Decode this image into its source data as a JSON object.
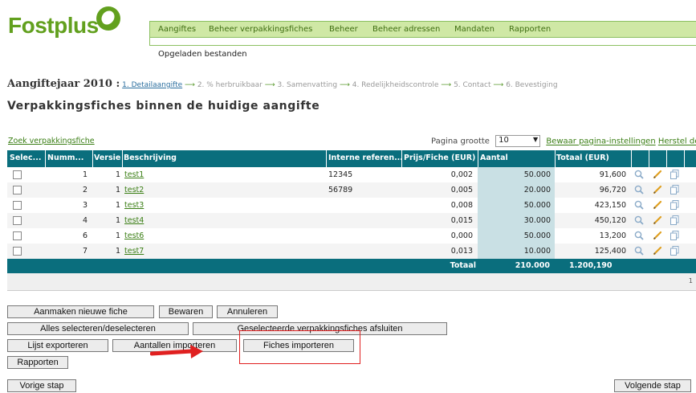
{
  "brand": {
    "name": "Fostplus",
    "color": "#62a01e"
  },
  "top_cut_text": "",
  "nav": {
    "items": [
      "Aangiftes",
      "Beheer verpakkingsfiches",
      "Beheer",
      "Beheer adressen",
      "Mandaten",
      "Rapporten"
    ],
    "sub": "Opgeladen bestanden"
  },
  "steps": {
    "year_label": "Aangiftejaar 2010 :",
    "items": [
      "1. Detailaangifte",
      "2. % herbruikbaar",
      "3. Samenvatting",
      "4. Redelijkheidscontrole",
      "5. Contact",
      "6. Bevestiging"
    ],
    "arrow": "⟶"
  },
  "title": "Verpakkingsfiches binnen de huidige aangifte",
  "search_link": "Zoek verpakkingsfiche",
  "paging": {
    "label": "Pagina grootte",
    "size": "10",
    "save_link": "Bewaar pagina-instellingen",
    "reset_link": "Herstel defau"
  },
  "table": {
    "headers": [
      "Selec...",
      "Numm...",
      "Versie",
      "Beschrijving",
      "Interne referen...",
      "Prijs/Fiche (EUR)",
      "Aantal",
      "Totaal (EUR)"
    ],
    "rows": [
      {
        "num": "1",
        "versie": "1",
        "desc": "test1",
        "ref": "12345",
        "prijs": "0,002",
        "aantal": "50.000",
        "totaal": "91,600"
      },
      {
        "num": "2",
        "versie": "1",
        "desc": "test2",
        "ref": "56789",
        "prijs": "0,005",
        "aantal": "20.000",
        "totaal": "96,720"
      },
      {
        "num": "3",
        "versie": "1",
        "desc": "test3",
        "ref": "",
        "prijs": "0,008",
        "aantal": "50.000",
        "totaal": "423,150"
      },
      {
        "num": "4",
        "versie": "1",
        "desc": "test4",
        "ref": "",
        "prijs": "0,015",
        "aantal": "30.000",
        "totaal": "450,120"
      },
      {
        "num": "6",
        "versie": "1",
        "desc": "test6",
        "ref": "",
        "prijs": "0,000",
        "aantal": "50.000",
        "totaal": "13,200"
      },
      {
        "num": "7",
        "versie": "1",
        "desc": "test7",
        "ref": "",
        "prijs": "0,013",
        "aantal": "10.000",
        "totaal": "125,400"
      }
    ],
    "totals": {
      "label": "Totaal",
      "aantal": "210.000",
      "totaal": "1.200,190"
    },
    "page_number": "1",
    "header_color": "#0a6e7d"
  },
  "buttons": {
    "new_fiche": "Aanmaken nieuwe fiche",
    "save": "Bewaren",
    "cancel": "Annuleren",
    "select_all": "Alles selecteren/deselecteren",
    "close_selected": "Geselecteerde verpakkingsfiches afsluiten",
    "export_list": "Lijst exporteren",
    "import_counts": "Aantallen importeren",
    "import_fiches": "Fiches importeren",
    "reports": "Rapporten",
    "prev_step": "Vorige stap",
    "next_step": "Volgende stap"
  },
  "highlight_color": "#e02020"
}
